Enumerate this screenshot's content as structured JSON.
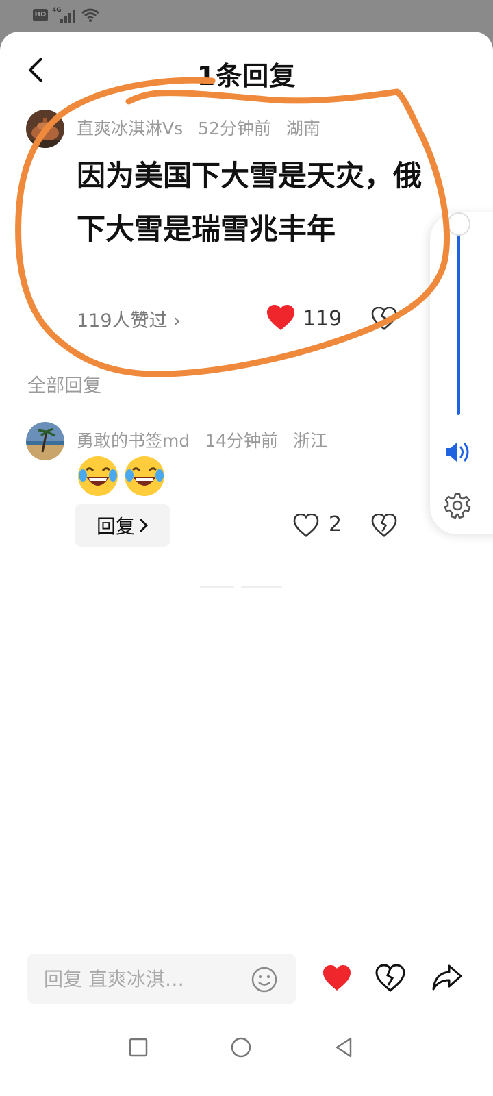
{
  "status_bar": {
    "hd": "HD",
    "network": "4G"
  },
  "header": {
    "title": "1条回复"
  },
  "main_comment": {
    "username": "直爽冰淇淋Vs",
    "time": "52分钟前",
    "location": "湖南",
    "content": "因为美国下大雪是天灾，俄下大雪是瑞雪兆丰年",
    "likers_text": "119人赞过 ›",
    "like_count": "119"
  },
  "section": {
    "label": "全部回复"
  },
  "reply": {
    "username": "勇敢的书签md",
    "time": "14分钟前",
    "location": "浙江",
    "emojis": [
      "😂",
      "😂"
    ],
    "reply_button": "回复",
    "like_count": "2"
  },
  "input_bar": {
    "placeholder": "回复 直爽冰淇…"
  },
  "colors": {
    "liked_red": "#f0262d",
    "annotation_orange": "#ef8a3c",
    "volume_blue": "#1f63e0"
  },
  "volume": {
    "level": 1.0
  },
  "icons": [
    "back-icon",
    "heart-icon",
    "broken-heart-icon",
    "volume-icon",
    "settings-icon",
    "smile-icon",
    "share-icon",
    "square-nav-icon",
    "circle-nav-icon",
    "triangle-nav-icon"
  ]
}
